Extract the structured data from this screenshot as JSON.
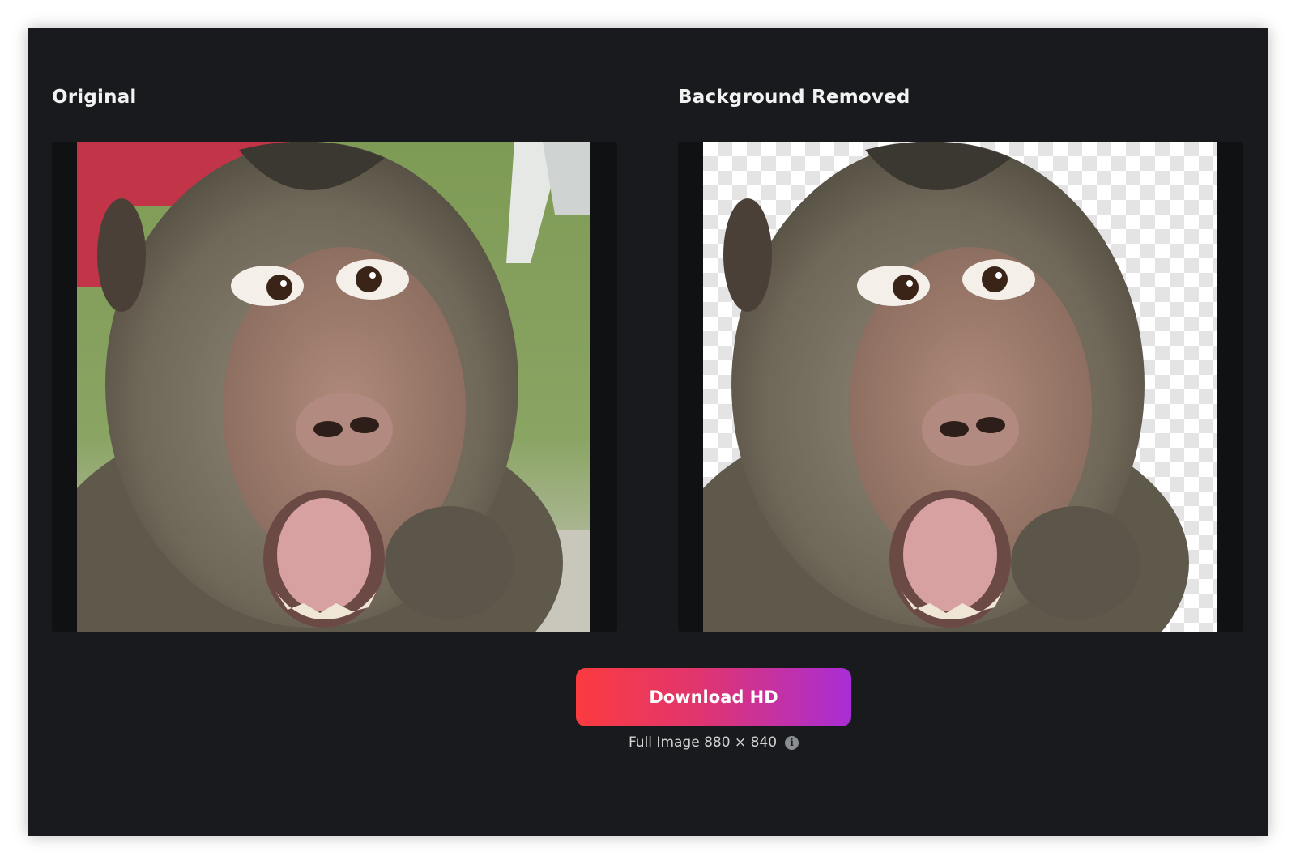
{
  "panels": {
    "original": {
      "title": "Original",
      "image_description_name": "monkey-photo-original"
    },
    "removed": {
      "title": "Background Removed",
      "image_description_name": "monkey-photo-background-removed"
    }
  },
  "download": {
    "button_label": "Download HD",
    "gradient_start": "#fb3b3f",
    "gradient_end": "#a92dd6"
  },
  "image_info": {
    "text": "Full Image 880 × 840",
    "icon": "info-icon",
    "icon_glyph": "i"
  },
  "colors": {
    "background": "#181a1d",
    "well": "#0f1113",
    "title_text": "#f2f2f2"
  }
}
